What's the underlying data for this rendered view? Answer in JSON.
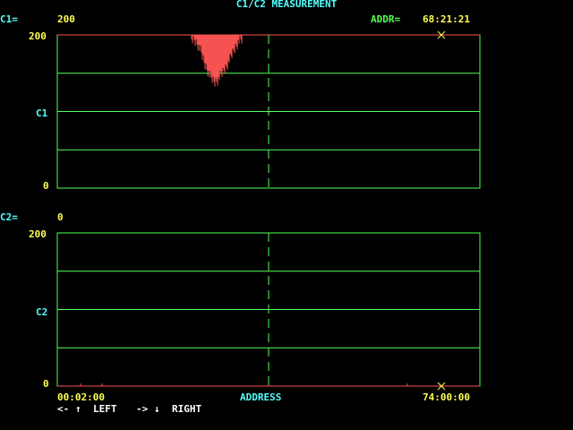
{
  "screen": {
    "title": "C1/C2 MEASUREMENT"
  },
  "channel1": {
    "label": "C1=",
    "value": "200",
    "addr_label": "ADDR=",
    "addr_value": "68:21:21",
    "y_top": "200",
    "y_mid": "C1",
    "y_bottom": "0"
  },
  "channel2": {
    "label": "C2=",
    "value": "0",
    "y_top": "200",
    "y_mid": "C2",
    "y_bottom": "0"
  },
  "footer": {
    "x_start": "00:02:00",
    "x_label": "ADDRESS",
    "x_end": "74:00:00",
    "left_hint": "<-",
    "left_arrow": "↑",
    "left_text": "LEFT",
    "right_hint": "->",
    "right_arrow": "↓",
    "right_text": "RIGHT"
  },
  "colors": {
    "grid": "#55ff55",
    "signal": "#ff5555",
    "cursor": "#ffff55",
    "label": "#55ffff",
    "value": "#ffff55"
  },
  "chart_data": [
    {
      "type": "area",
      "series": [
        {
          "values_c1": [
            200,
            200,
            195,
            185,
            170,
            160,
            150,
            145,
            148,
            155,
            162,
            170,
            180,
            190,
            198,
            200
          ]
        }
      ],
      "x_range_fraction": [
        0.32,
        0.44
      ],
      "ylim": [
        0,
        200
      ],
      "grid": true,
      "cursor_x_fraction": 0.5
    },
    {
      "type": "area",
      "series": [
        {
          "values_c2": [
            0,
            0,
            0,
            0
          ]
        }
      ],
      "ylim": [
        0,
        200
      ],
      "grid": true,
      "cursor_x_fraction": 0.5
    }
  ]
}
